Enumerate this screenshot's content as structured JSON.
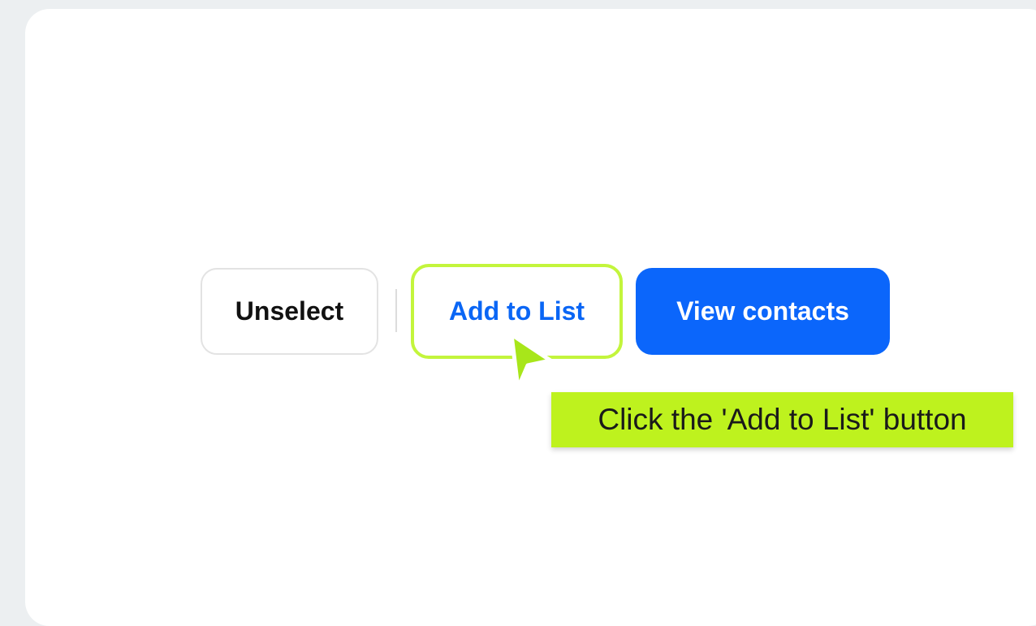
{
  "toolbar": {
    "unselect_label": "Unselect",
    "add_to_list_label": "Add to List",
    "view_contacts_label": "View contacts"
  },
  "hint": {
    "text": "Click the 'Add to List' button"
  },
  "colors": {
    "page_background": "#eceff1",
    "card_background": "#ffffff",
    "primary_blue": "#0b66fb",
    "highlight_green": "#c3f53c",
    "tooltip_green": "#bef21e"
  },
  "icons": {
    "cursor": "pointer-cursor-icon"
  }
}
